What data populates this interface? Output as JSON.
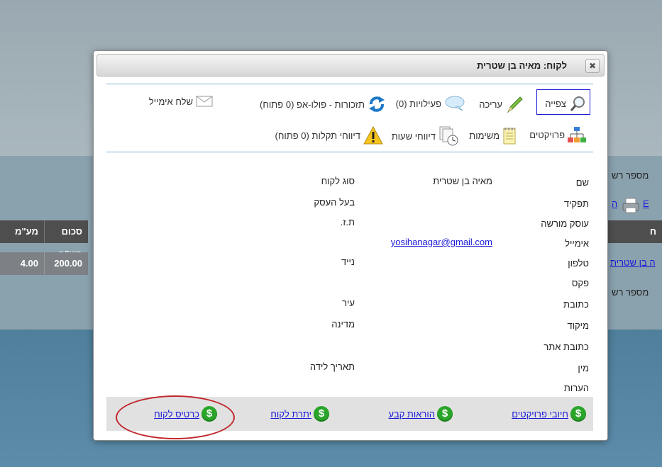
{
  "background": {
    "label_record_no_1": "מספר רש",
    "label_record_no_2": "מספר רש",
    "col_sum_nis": "סכום בש\"ח",
    "col_vat": "מע\"מ",
    "cell_vat": "4.00",
    "cell_sum": "200.00",
    "col_right": "ח",
    "row_name_link": "ה בן שטרית",
    "link_fragment_1": "ה",
    "link_fragment_2": "E"
  },
  "dialog": {
    "title": "לקוח: מאיה בן שטרית",
    "close_symbol": "✖"
  },
  "toolbar": {
    "row1": [
      {
        "label": "צפייה",
        "icon": "magnifier-icon"
      },
      {
        "label": "עריכה",
        "icon": "pencil-icon"
      },
      {
        "label": "פעילויות (0)",
        "icon": "speech-bubble-icon"
      },
      {
        "label": "תזכורות - פולו-אפ (0 פתוח)",
        "icon": "refresh-icon"
      },
      {
        "label": "שלח אימייל",
        "icon": "envelope-icon"
      }
    ],
    "row2": [
      {
        "label": "פרויקטים",
        "icon": "org-chart-icon"
      },
      {
        "label": "משימות",
        "icon": "notepad-icon"
      },
      {
        "label": "דיווחי שעות",
        "icon": "clock-document-icon"
      },
      {
        "label": "דיווחי תקלות (0 פתוח)",
        "icon": "warning-icon"
      }
    ]
  },
  "details": {
    "name_label": "שם",
    "name_value": "מאיה בן שטרית",
    "customer_type_label": "סוג לקוח",
    "role_label": "תפקיד",
    "role_value": "בעל העסק",
    "licensed_dealer_label": "עוסק מורשה",
    "id_label": "ת.ז.",
    "email_label": "אימייל",
    "email_value": "yosihanagar@gmail.com",
    "phone_label": "טלפון",
    "mobile_label": "נייד",
    "fax_label": "פקס",
    "address_label": "כתובת",
    "city_label": "עיר",
    "zip_label": "מיקוד",
    "country_label": "מדינה",
    "website_label": "כתובת אתר",
    "gender_label": "מין",
    "birthdate_label": "תאריך לידה",
    "notes_label": "הערות"
  },
  "footer": {
    "project_charges": "חיובי פרויקטים",
    "standing_orders": "הוראות קבע",
    "customer_balance": "יתרת לקוח",
    "customer_card": "כרטיס לקוח",
    "dollar_symbol": "$"
  },
  "colors": {
    "link": "#1b1bd8",
    "dollar_green": "#2aa52a",
    "highlight_red": "#c0262b"
  }
}
